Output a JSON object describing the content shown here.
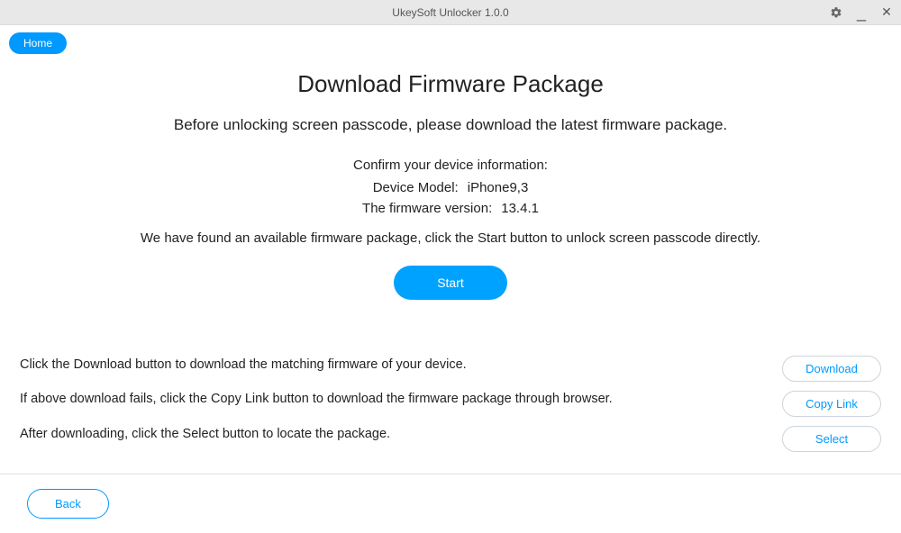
{
  "titlebar": {
    "title": "UkeySoft Unlocker 1.0.0"
  },
  "nav": {
    "home_label": "Home"
  },
  "main": {
    "title": "Download Firmware Package",
    "subtitle": "Before unlocking screen passcode, please download the latest firmware package.",
    "confirm_label": "Confirm your device information:",
    "device_model_label": "Device Model:",
    "device_model_value": "iPhone9,3",
    "firmware_label": "The firmware version:",
    "firmware_value": "13.4.1",
    "status_text": "We have found an available firmware package, click the Start button to unlock screen passcode directly.",
    "start_label": "Start"
  },
  "actions": {
    "line1": "Click the Download button to download the matching firmware of your device.",
    "line2": "If above download fails, click the Copy Link button to download the firmware package through browser.",
    "line3": "After downloading, click the Select button to locate the package.",
    "download_label": "Download",
    "copylink_label": "Copy Link",
    "select_label": "Select"
  },
  "footer": {
    "back_label": "Back"
  }
}
